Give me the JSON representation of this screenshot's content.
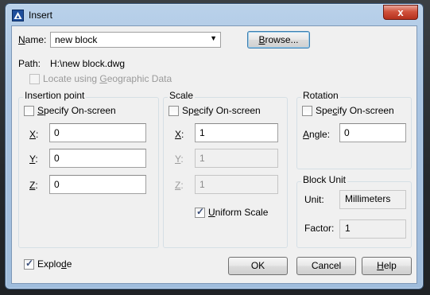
{
  "window": {
    "title": "Insert",
    "close_label": "x"
  },
  "name": {
    "label": "Name:",
    "value": "new block",
    "browse_label": "Browse..."
  },
  "path": {
    "label": "Path:",
    "value": "H:\\new block.dwg"
  },
  "geo": {
    "label": "Locate using Geographic Data",
    "checked": false,
    "enabled": false
  },
  "insertion": {
    "title": "Insertion point",
    "specify_label": "Specify On-screen",
    "x_label": "X:",
    "x_value": "0",
    "y_label": "Y:",
    "y_value": "0",
    "z_label": "Z:",
    "z_value": "0"
  },
  "scale": {
    "title": "Scale",
    "specify_label": "Specify On-screen",
    "x_label": "X:",
    "x_value": "1",
    "y_label": "Y:",
    "y_value": "1",
    "z_label": "Z:",
    "z_value": "1",
    "uniform_label": "Uniform Scale",
    "uniform_checked": true
  },
  "rotation": {
    "title": "Rotation",
    "specify_label": "Specify On-screen",
    "angle_label": "Angle:",
    "angle_value": "0"
  },
  "block_unit": {
    "title": "Block Unit",
    "unit_label": "Unit:",
    "unit_value": "Millimeters",
    "factor_label": "Factor:",
    "factor_value": "1"
  },
  "explode": {
    "label": "Explode",
    "checked": true
  },
  "buttons": {
    "ok": "OK",
    "cancel": "Cancel",
    "help": "Help"
  }
}
